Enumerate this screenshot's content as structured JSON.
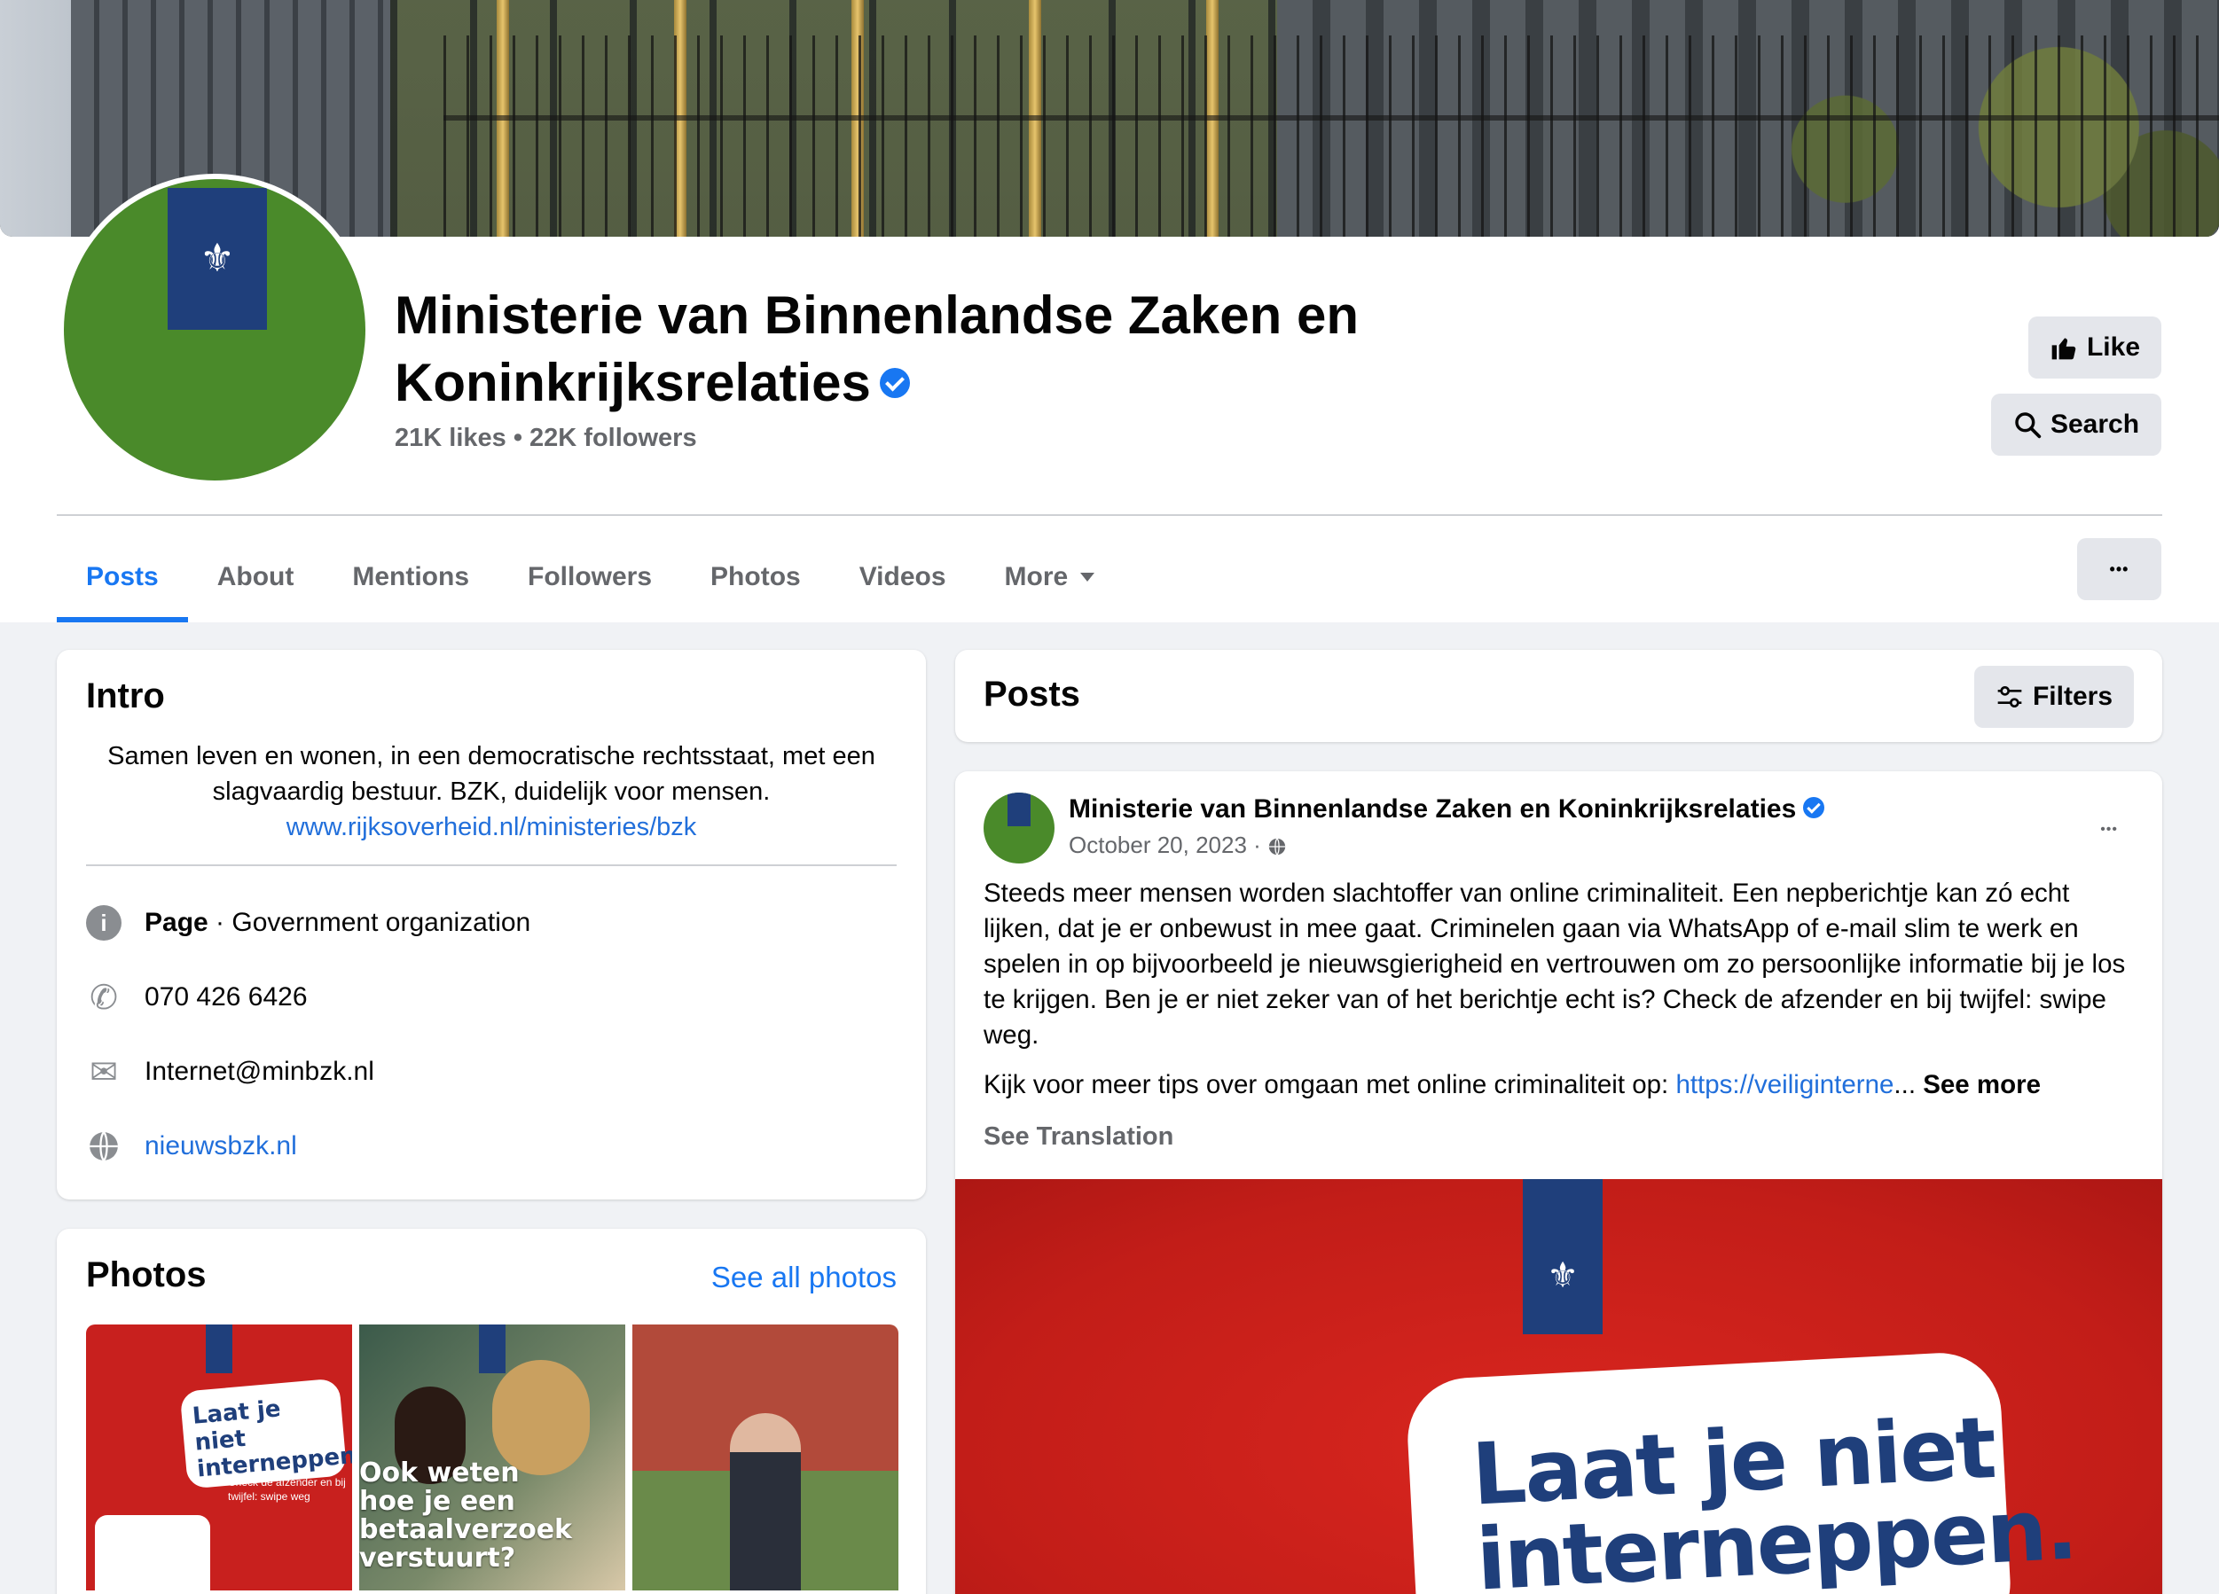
{
  "page": {
    "name_line1": "Ministerie van Binnenlandse Zaken en",
    "name_line2": "Koninkrijksrelaties",
    "stats": "21K likes • 22K followers"
  },
  "actions": {
    "like": "Like",
    "search": "Search",
    "more_dots": "•••"
  },
  "tabs": [
    {
      "label": "Posts",
      "active": true
    },
    {
      "label": "About"
    },
    {
      "label": "Mentions"
    },
    {
      "label": "Followers"
    },
    {
      "label": "Photos"
    },
    {
      "label": "Videos"
    },
    {
      "label": "More"
    }
  ],
  "intro": {
    "title": "Intro",
    "bio": "Samen leven en wonen, in een democratische rechtsstaat, met een slagvaardig bestuur. BZK, duidelijk voor mensen.",
    "bio_link": "www.rijksoverheid.nl/ministeries/bzk",
    "category_label": "Page",
    "category_value": " · Government organization",
    "phone": "070 426 6426",
    "email": "Internet@minbzk.nl",
    "website": "nieuwsbzk.nl"
  },
  "photos": {
    "title": "Photos",
    "see_all": "See all photos",
    "thumb1_slogan": "Laat je niet interneppen.",
    "thumb1_small": "Check de afzender en bij twijfel: swipe weg",
    "thumb2_text": "Ook weten hoe je een betaalverzoek verstuurt?"
  },
  "posts": {
    "title": "Posts",
    "filters": "Filters"
  },
  "post": {
    "author": "Ministerie van Binnenlandse Zaken en Koninkrijksrelaties",
    "date": "October 20, 2023 ·",
    "text1": "Steeds meer mensen worden slachtoffer van online criminaliteit. Een nepberichtje kan zó echt lijken, dat je er onbewust in mee gaat. Criminelen gaan via WhatsApp of e-mail slim te werk en spelen in op bijvoorbeeld je nieuwsgierigheid en vertrouwen om zo persoonlijke informatie bij je los te krijgen. Ben je er niet zeker van of het berichtje echt is? Check de afzender en bij twijfel: swipe weg.",
    "text2_prefix": "Kijk voor meer tips over omgaan met online criminaliteit op: ",
    "text2_link": "https://veiliginterne",
    "text2_ellipsis": "... ",
    "see_more": "See more",
    "see_translation": "See Translation",
    "media_slogan_line1": "Laat je niet",
    "media_slogan_line2": "interneppen."
  },
  "colors": {
    "accent": "#1877f2",
    "link": "#216fdb",
    "muted": "#65676b",
    "avatar_green": "#4a8a2a",
    "rijks_blue": "#1f3f7b",
    "campaign_red": "#c8201e"
  },
  "icons": [
    "thumbs-up-icon",
    "search-icon",
    "filters-icon",
    "info-icon",
    "phone-icon",
    "email-icon",
    "globe-icon",
    "verified-badge-icon",
    "more-dots-icon",
    "caret-down-icon"
  ]
}
